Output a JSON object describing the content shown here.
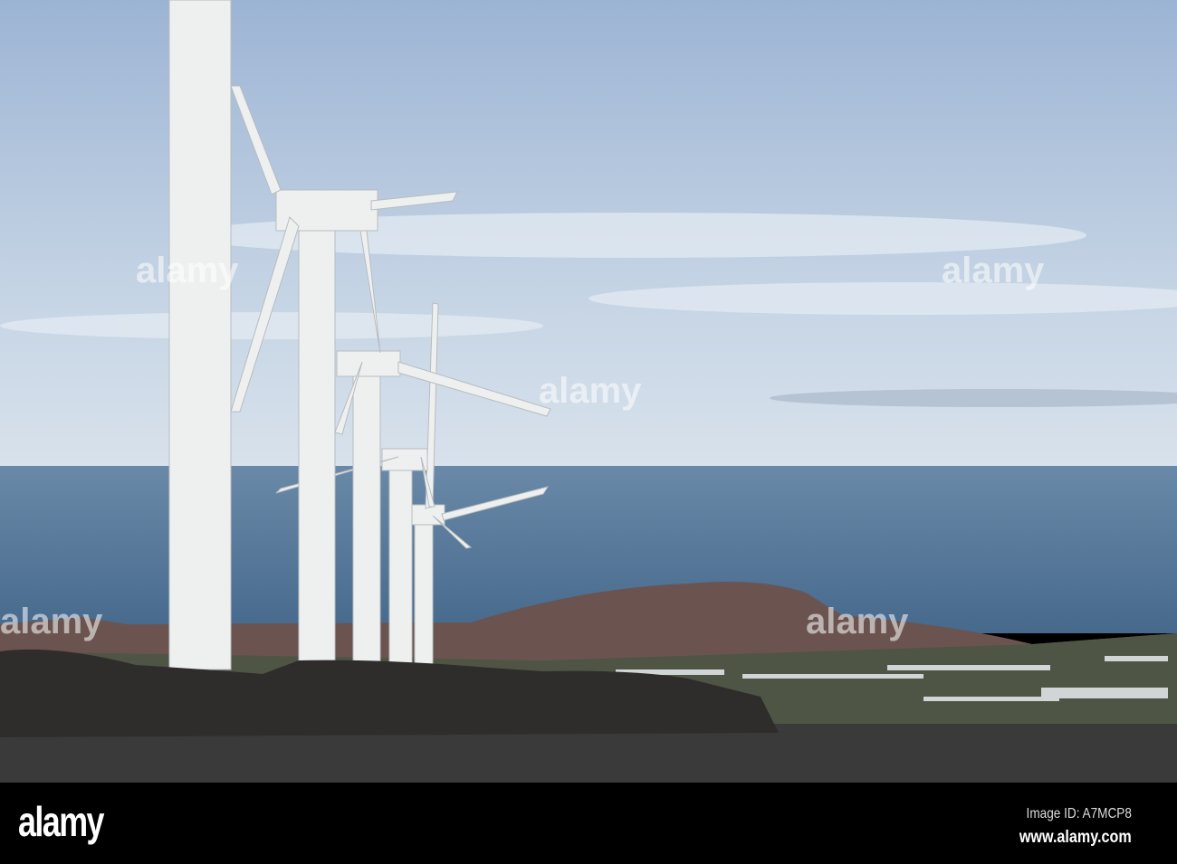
{
  "watermark": {
    "logo": "alamy"
  },
  "banner": {
    "logo": "alamy",
    "image_id": "Image ID: A7MCP8",
    "website": "www.alamy.com"
  },
  "colors": {
    "sky_top": "#9fb6d6",
    "sky_bottom": "#cfdbe8",
    "sea": "#4f7193",
    "ground": "#3a3a3a",
    "turbine": "#eef0f0"
  }
}
